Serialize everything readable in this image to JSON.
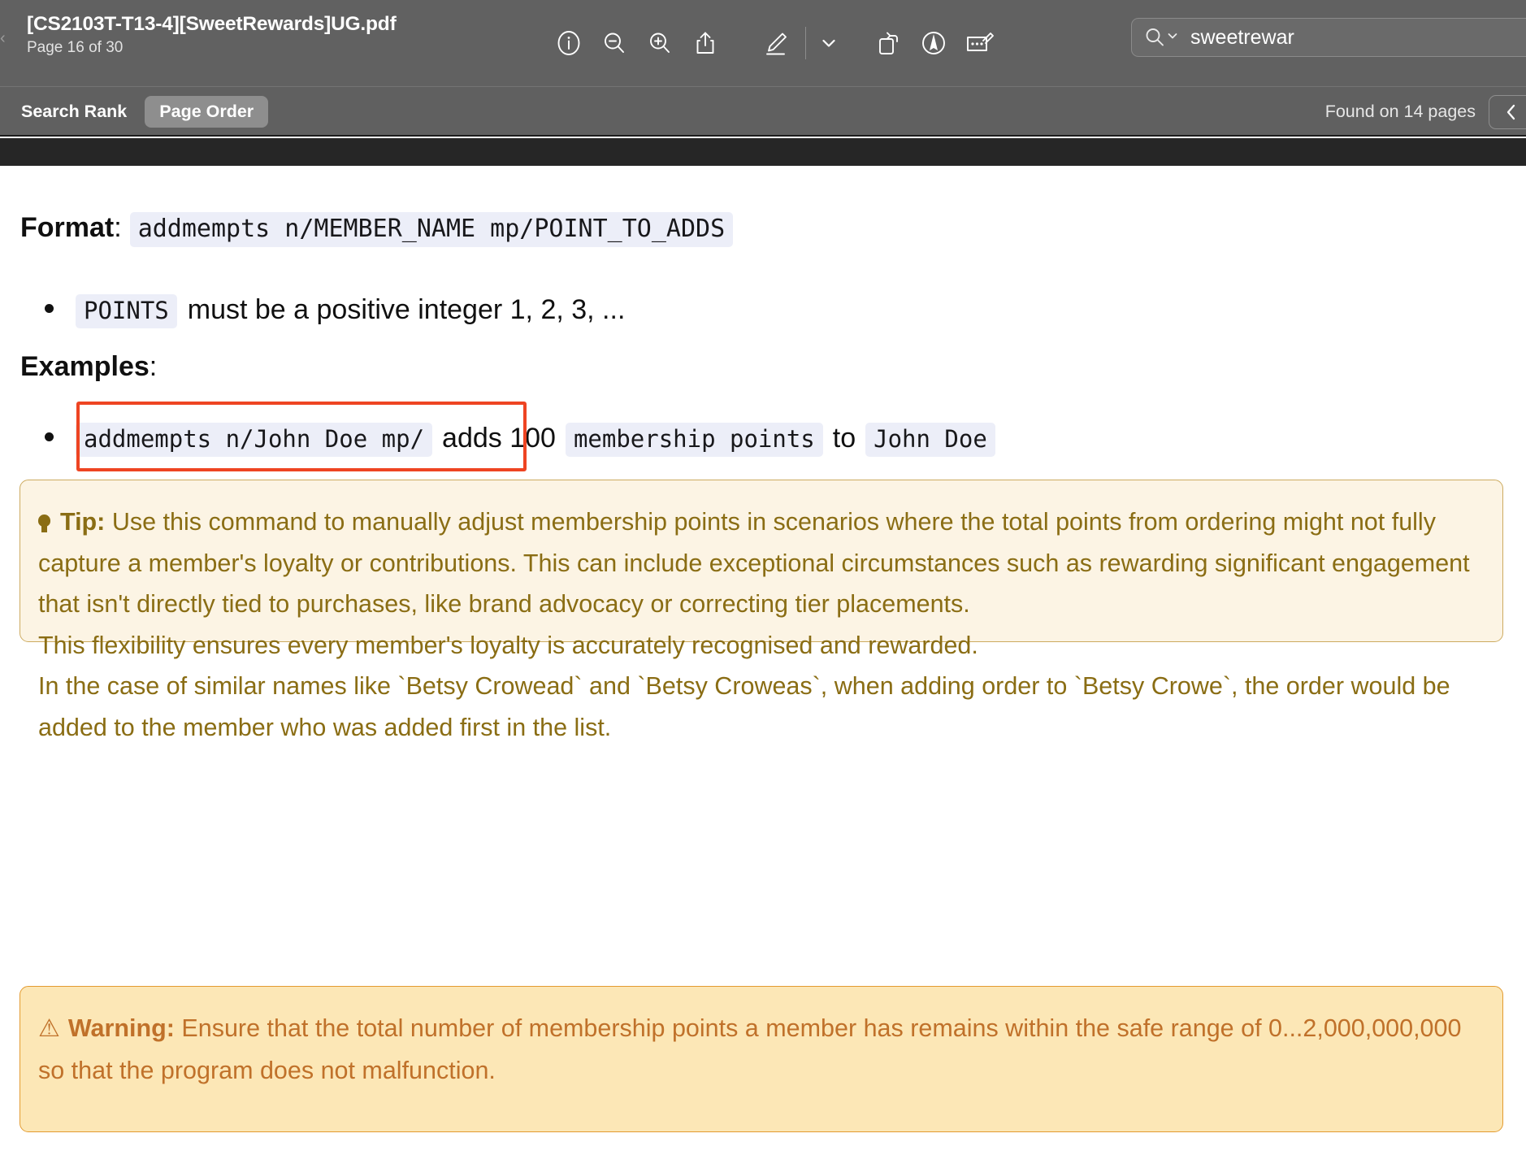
{
  "toolbar": {
    "doc_title": "[CS2103T-T13-4][SweetRewards]UG.pdf",
    "page_indicator": "Page 16 of 30",
    "icons": [
      {
        "name": "info-icon",
        "label": "Info"
      },
      {
        "name": "zoom-out-icon",
        "label": "Zoom Out"
      },
      {
        "name": "zoom-in-icon",
        "label": "Zoom In"
      },
      {
        "name": "share-icon",
        "label": "Share"
      },
      {
        "name": "markup-pen-icon",
        "label": "Markup"
      },
      {
        "name": "chevron-down-icon",
        "label": "More Markup Tools"
      },
      {
        "name": "rotate-icon",
        "label": "Rotate"
      },
      {
        "name": "sign-icon",
        "label": "Sign"
      },
      {
        "name": "annotate-note-icon",
        "label": "Annotate"
      }
    ]
  },
  "search": {
    "value": "sweetrewar",
    "placeholder": "Search",
    "icon": "search-icon",
    "dropdown_icon": "chevron-down-icon"
  },
  "subbar": {
    "sort_search_rank": "Search Rank",
    "sort_page_order": "Page Order",
    "active_sort": "Page Order",
    "found_text": "Found on 14 pages",
    "prev_icon": "chevron-left-icon"
  },
  "document": {
    "format_label": "Format",
    "format_colon": ":",
    "format_code": "addmempts n/MEMBER_NAME mp/POINT_TO_ADDS",
    "points_code": "POINTS",
    "points_text": "must be a positive integer 1, 2, 3, ...",
    "examples_label": "Examples",
    "examples_colon": ":",
    "example_code_cmd": "addmempts n/John Doe mp/",
    "example_text_1": "adds 100",
    "example_code_points": "membership points",
    "example_text_2": "to",
    "example_code_name": "John Doe",
    "highlight_color": "#ee4422"
  },
  "tip_box": {
    "icon": "lightbulb-icon",
    "heading": "Tip:",
    "body": "Use this command to manually adjust membership points in scenarios where the total points from ordering might not fully capture a member's loyalty or contributions. This can include exceptional circumstances such as rewarding significant engagement that isn't directly tied to purchases, like brand advocacy or correcting tier placements.",
    "body_line2": "This flexibility ensures every member's loyalty is accurately recognised and rewarded.",
    "body_line3": "In the case of similar names like `Betsy Crowead` and `Betsy Croweas`, when adding order to `Betsy Crowe`, the order would be added to the member who was added first in the list.",
    "bg_color": "#fcf4e4",
    "border_color": "#cdab60",
    "text_color": "#8a6d14"
  },
  "warning_box": {
    "icon": "warning-triangle-icon",
    "icon_glyph": "⚠",
    "heading": "Warning:",
    "body": "Ensure that the total number of membership points a member has remains within the safe range of 0...2,000,000,000 so that the program does not malfunction.",
    "bg_color": "#fce7b6",
    "border_color": "#e39b30",
    "text_color": "#c0712a"
  }
}
